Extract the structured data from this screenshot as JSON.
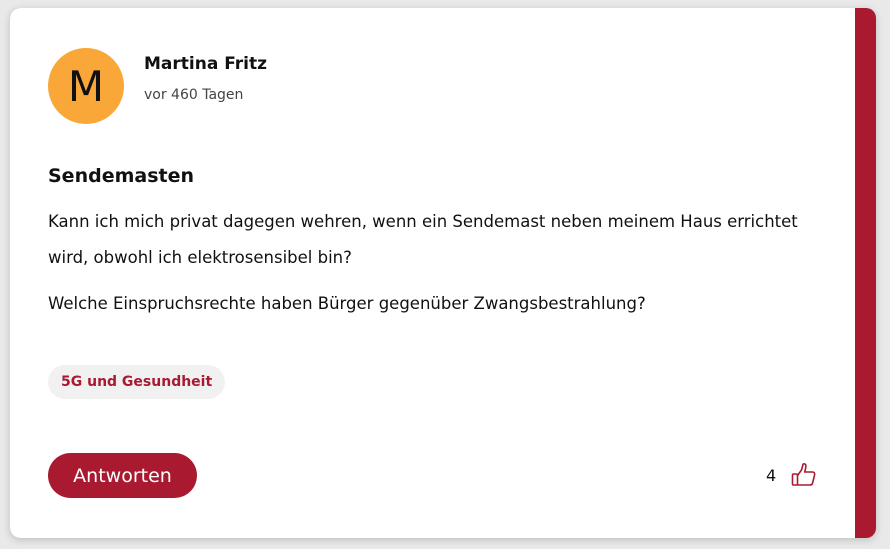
{
  "post": {
    "author": {
      "initial": "M",
      "name": "Martina Fritz",
      "timestamp": "vor 460 Tagen",
      "avatar_color": "#f9a738"
    },
    "title": "Sendemasten",
    "body_paragraphs": [
      "Kann ich mich privat dagegen wehren, wenn ein Sendemast neben meinem Haus errichtet wird, obwohl ich elektrosensibel bin?",
      "Welche Einspruchsrechte haben Bürger gegenüber Zwangsbestrahlung?"
    ],
    "tag": "5G und Gesundheit",
    "reply_label": "Antworten",
    "like_count": "4",
    "like_icon": "thumbs-up-icon"
  },
  "colors": {
    "accent": "#a91a31",
    "tag_background": "#f1f1f2",
    "avatar": "#f9a738"
  }
}
